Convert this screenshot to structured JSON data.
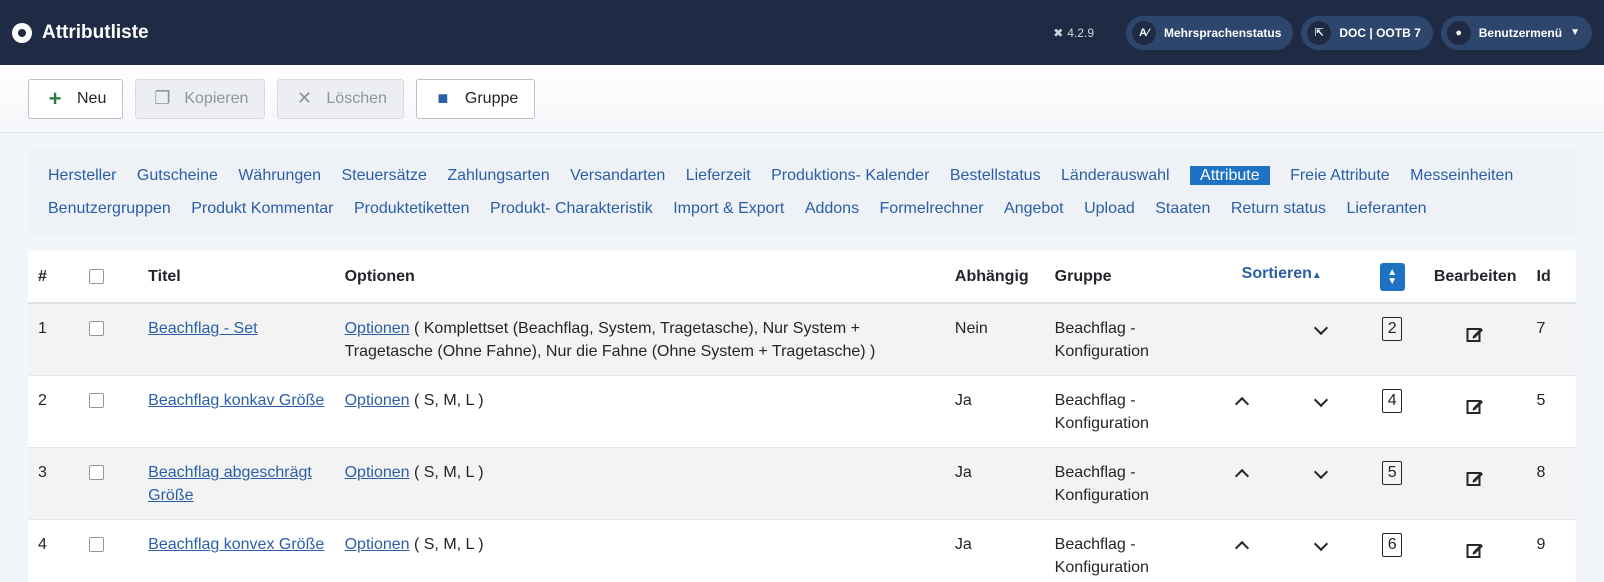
{
  "header": {
    "title": "Attributliste",
    "version": "4.2.9",
    "buttons": [
      {
        "label": "Mehrsprachenstatus",
        "icon": "language-icon"
      },
      {
        "label": "DOC | OOTB 7",
        "icon": "external-link-icon"
      },
      {
        "label": "Benutzermenü",
        "icon": "user-icon"
      }
    ]
  },
  "toolbar": {
    "new_label": "Neu",
    "copy_label": "Kopieren",
    "delete_label": "Löschen",
    "group_label": "Gruppe"
  },
  "submenu": {
    "items": [
      "Hersteller",
      "Gutscheine",
      "Währungen",
      "Steuersätze",
      "Zahlungsarten",
      "Versandarten",
      "Lieferzeit",
      "Produktions- Kalender",
      "Bestellstatus",
      "Länderauswahl",
      "Attribute",
      "Freie Attribute",
      "Messeinheiten",
      "Benutzergruppen",
      "Produkt Kommentar",
      "Produktetiketten",
      "Produkt- Charakteristik",
      "Import & Export",
      "Addons",
      "Formelrechner",
      "Angebot",
      "Upload",
      "Staaten",
      "Return status",
      "Lieferanten"
    ],
    "active": "Attribute"
  },
  "table": {
    "headers": {
      "num": "#",
      "title": "Titel",
      "options": "Optionen",
      "dependent": "Abhängig",
      "group": "Gruppe",
      "sort": "Sortieren",
      "edit": "Bearbeiten",
      "id": "Id"
    },
    "rows": [
      {
        "num": "1",
        "title": "Beachflag - Set",
        "options_link": "Optionen",
        "options": "( Komplettset (Beachflag, System, Tragetasche), Nur System + Tragetasche (Ohne Fahne), Nur die Fahne (Ohne System + Tragetasche) )",
        "dependent": "Nein",
        "group": "Beachflag - Konfiguration",
        "order": "2",
        "id": "7"
      },
      {
        "num": "2",
        "title": "Beachflag konkav Größe",
        "options_link": "Optionen",
        "options": "( S, M, L )",
        "dependent": "Ja",
        "group": "Beachflag - Konfiguration",
        "order": "4",
        "id": "5"
      },
      {
        "num": "3",
        "title": "Beachflag abgeschrägt Größe",
        "options_link": "Optionen",
        "options": "( S, M, L )",
        "dependent": "Ja",
        "group": "Beachflag - Konfiguration",
        "order": "5",
        "id": "8"
      },
      {
        "num": "4",
        "title": "Beachflag konvex Größe",
        "options_link": "Optionen",
        "options": "( S, M, L )",
        "dependent": "Ja",
        "group": "Beachflag - Konfiguration",
        "order": "6",
        "id": "9"
      }
    ]
  }
}
